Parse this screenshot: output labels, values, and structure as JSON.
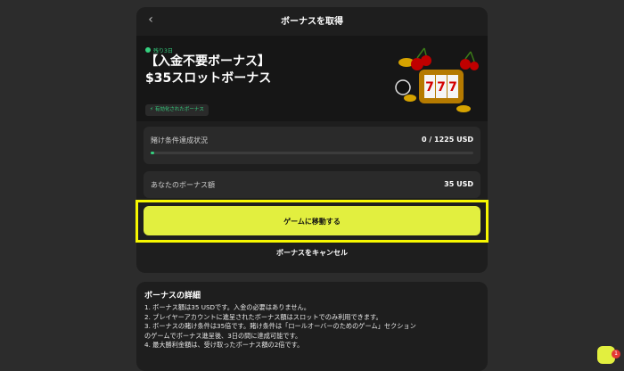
{
  "header": {
    "back_icon": "chevron-left-icon",
    "title": "ボーナスを取得"
  },
  "hero": {
    "days_left": "残り3日",
    "title_line1": "【入金不要ボーナス】",
    "title_line2": "$35スロットボーナス",
    "status_badge": "有効化されたボーナス",
    "image": "slot-machine-777-illustration"
  },
  "wager": {
    "label": "賭け条件達成状況",
    "value": "0 / 1225 USD",
    "progress": 0.0
  },
  "bonus_amount": {
    "label": "あなたのボーナス額",
    "value": "35 USD"
  },
  "actions": {
    "play_label": "ゲームに移動する",
    "cancel_label": "ボーナスをキャンセル"
  },
  "details": {
    "title": "ボーナスの詳細",
    "lines": [
      "1. ボーナス額は35 USDです。入金の必要はありません。",
      "2. プレイヤーアカウントに進呈されたボーナス額はスロットでのみ利用できます。",
      "3. ボーナスの賭け条件は35倍です。賭け条件は「ロールオーバーのためのゲーム」セクション",
      "のゲームでボーナス進呈後、3日の間に達成可能です。",
      "4. 最大勝利金額は、受け取ったボーナス額の2倍です。"
    ]
  },
  "chat": {
    "icon": "chat-icon",
    "badge": "1"
  },
  "colors": {
    "accent": "#e2ef3f",
    "status_green": "#35d07f",
    "highlight": "#f7f700"
  }
}
